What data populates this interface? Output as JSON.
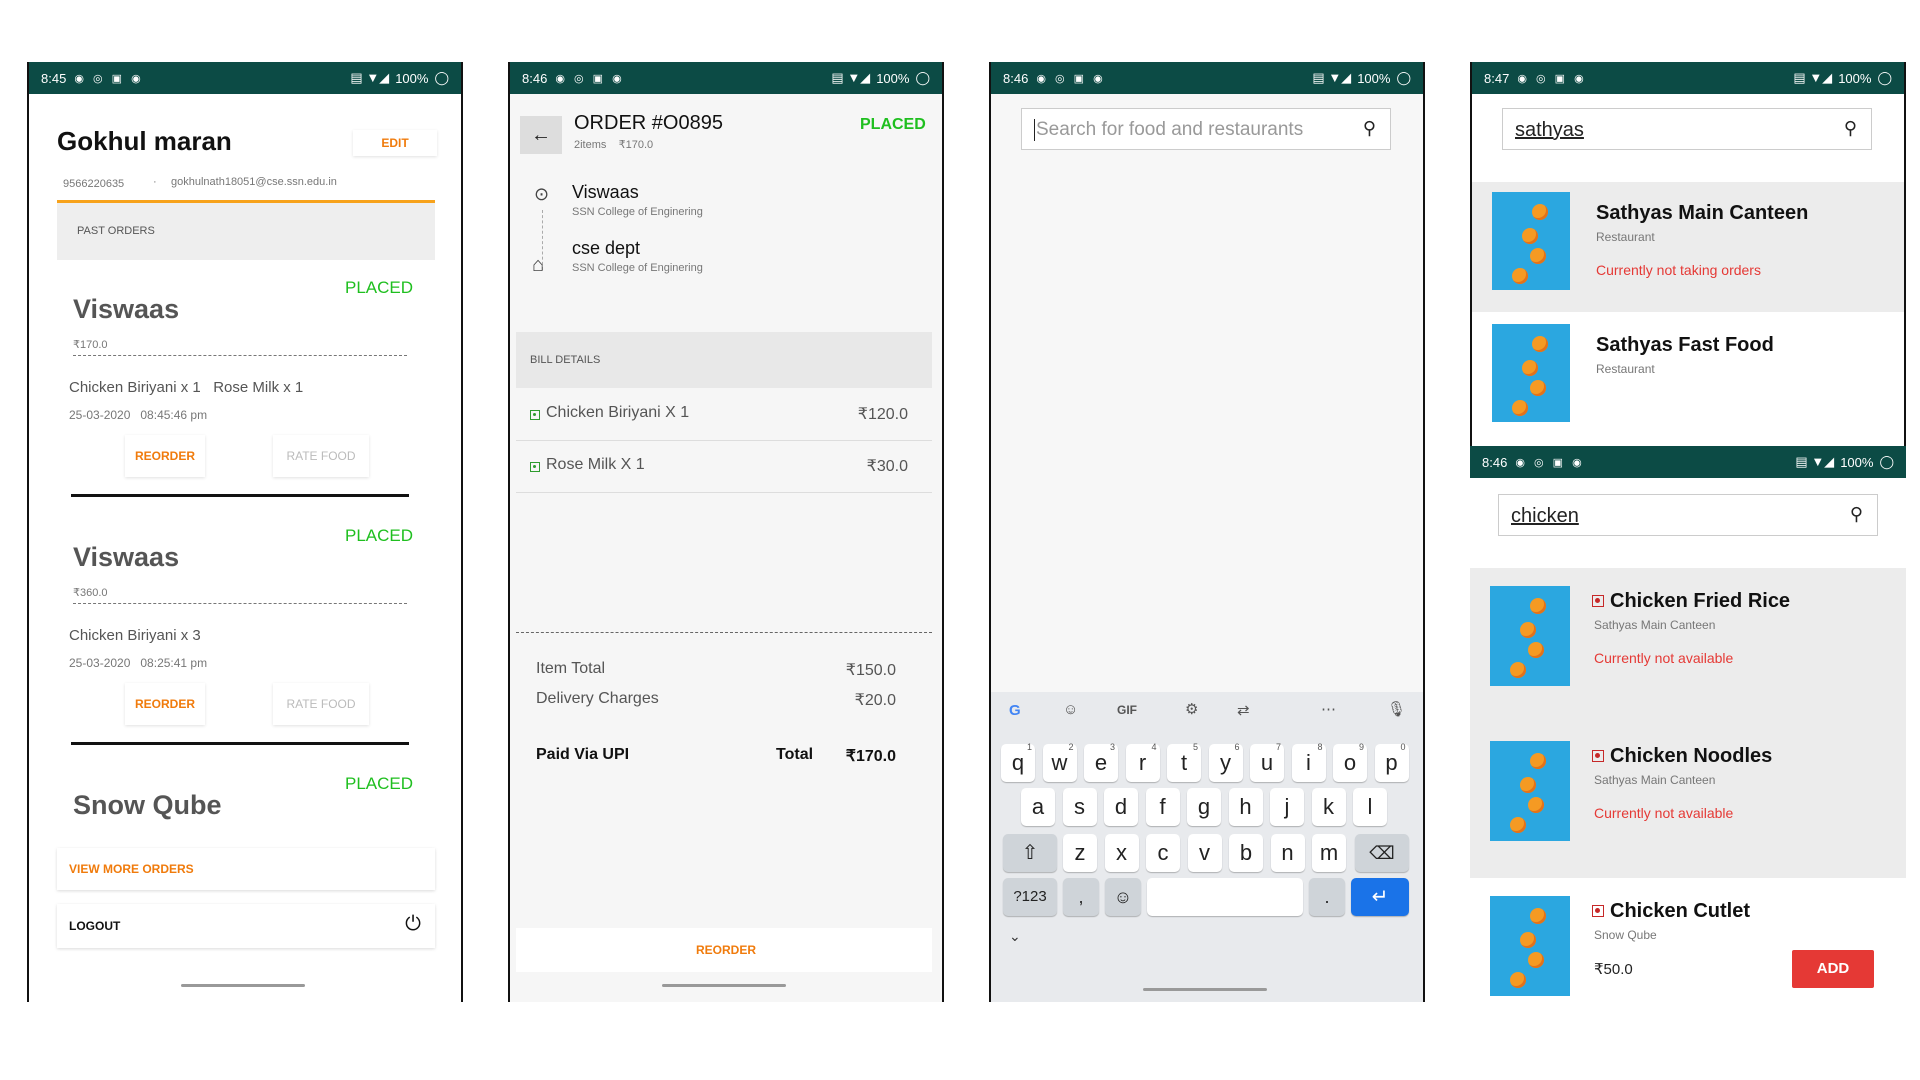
{
  "status": {
    "battery": "100%",
    "t845": "8:45",
    "t846": "8:46",
    "t847": "8:47"
  },
  "profile": {
    "name": "Gokhul maran",
    "edit_label": "EDIT",
    "phone": "9566220635",
    "email": "gokhulnath18051@cse.ssn.edu.in",
    "section_label": "PAST ORDERS",
    "orders": [
      {
        "restaurant": "Viswaas",
        "status": "PLACED",
        "amount": "₹170.0",
        "items": "Chicken Biriyani x 1   Rose Milk x 1",
        "datetime": "25-03-2020   08:45:46 pm",
        "reorder": "REORDER",
        "rate": "RATE FOOD"
      },
      {
        "restaurant": "Viswaas",
        "status": "PLACED",
        "amount": "₹360.0",
        "items": "Chicken Biriyani x 3",
        "datetime": "25-03-2020   08:25:41 pm",
        "reorder": "REORDER",
        "rate": "RATE FOOD"
      },
      {
        "restaurant": "Snow Qube",
        "status": "PLACED"
      }
    ],
    "view_more": "VIEW MORE ORDERS",
    "logout": "LOGOUT"
  },
  "order_detail": {
    "title": "ORDER #O0895",
    "status": "PLACED",
    "meta": "2items    ₹170.0",
    "from_name": "Viswaas",
    "from_sub": "SSN College of Enginering",
    "to_name": "cse dept",
    "to_sub": "SSN College of Enginering",
    "bill_label": "BILL DETAILS",
    "items": [
      {
        "name": "Chicken Biriyani X 1",
        "price": "₹120.0"
      },
      {
        "name": "Rose Milk X 1",
        "price": "₹30.0"
      }
    ],
    "item_total_label": "Item Total",
    "item_total": "₹150.0",
    "delivery_label": "Delivery Charges",
    "delivery": "₹20.0",
    "paid_via": "Paid Via UPI",
    "total_label": "Total",
    "total": "₹170.0",
    "reorder": "REORDER"
  },
  "search_empty": {
    "placeholder": "Search for food and restaurants",
    "keyboard": {
      "row1": [
        "q",
        "w",
        "e",
        "r",
        "t",
        "y",
        "u",
        "i",
        "o",
        "p"
      ],
      "row1_nums": [
        "1",
        "2",
        "3",
        "4",
        "5",
        "6",
        "7",
        "8",
        "9",
        "0"
      ],
      "row2": [
        "a",
        "s",
        "d",
        "f",
        "g",
        "h",
        "j",
        "k",
        "l"
      ],
      "row3": [
        "z",
        "x",
        "c",
        "v",
        "b",
        "n",
        "m"
      ],
      "sym": "?123",
      "comma": ",",
      "period": ".",
      "gif": "GIF"
    }
  },
  "search_restaurants": {
    "query": "sathyas",
    "results": [
      {
        "name": "Sathyas Main Canteen",
        "type": "Restaurant",
        "note": "Currently not taking orders"
      },
      {
        "name": "Sathyas Fast Food",
        "type": "Restaurant"
      }
    ]
  },
  "search_food": {
    "query": "chicken",
    "results": [
      {
        "name": "Chicken Fried Rice",
        "place": "Sathyas Main Canteen",
        "note": "Currently not available"
      },
      {
        "name": "Chicken Noodles",
        "place": "Sathyas Main Canteen",
        "note": "Currently not available"
      },
      {
        "name": "Chicken Cutlet",
        "place": "Snow Qube",
        "price": "₹50.0",
        "add": "ADD"
      }
    ]
  },
  "colors": {
    "status_bar": "#0c4b45",
    "placed": "#1fbf1f",
    "accent": "#f07b0c",
    "add": "#e53935"
  }
}
